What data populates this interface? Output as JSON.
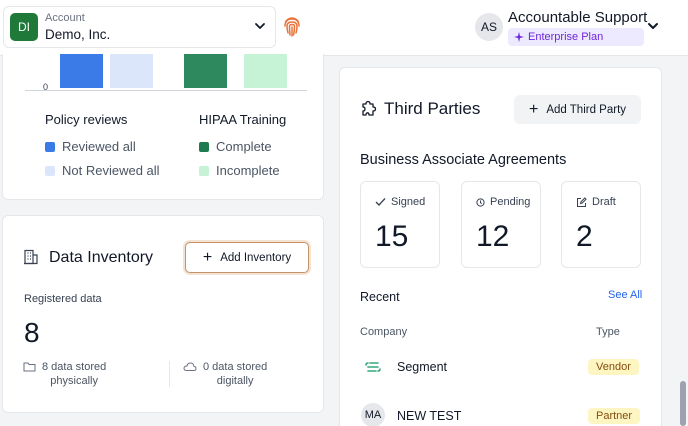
{
  "topbar": {
    "account": {
      "label": "Account",
      "initials": "DI",
      "name": "Demo, Inc."
    },
    "user": {
      "initials": "AS",
      "name": "Accountable Support",
      "plan": "Enterprise Plan"
    }
  },
  "policy_card": {
    "axis_zero": "0",
    "bars": [
      {
        "series": "Reviewed all",
        "color": "#3b7be8"
      },
      {
        "series": "Not Reviewed all",
        "color": "#dbe6fb"
      },
      {
        "series": "Complete",
        "color": "#2e8a5e"
      },
      {
        "series": "Incomplete",
        "color": "#c6f2d5"
      }
    ],
    "policy_reviews": {
      "title": "Policy reviews",
      "items": [
        {
          "label": "Reviewed all",
          "color": "#3b7be8"
        },
        {
          "label": "Not Reviewed all",
          "color": "#dbe6fb"
        }
      ]
    },
    "hipaa": {
      "title": "HIPAA Training",
      "items": [
        {
          "label": "Complete",
          "color": "#1f7a52"
        },
        {
          "label": "Incomplete",
          "color": "#c6f2d5"
        }
      ]
    }
  },
  "inventory": {
    "title": "Data Inventory",
    "add_label": "Add Inventory",
    "registered_label": "Registered data",
    "registered_value": "8",
    "physical": {
      "line1": "8 data stored",
      "line2": "physically"
    },
    "digital": {
      "line1": "0 data stored",
      "line2": "digitally"
    }
  },
  "third_parties": {
    "title": "Third Parties",
    "add_label": "Add Third Party",
    "baa_title": "Business Associate Agreements",
    "stats": [
      {
        "label": "Signed",
        "value": "15",
        "icon": "check-icon"
      },
      {
        "label": "Pending",
        "value": "12",
        "icon": "clock-icon"
      },
      {
        "label": "Draft",
        "value": "2",
        "icon": "edit-icon"
      }
    ],
    "recent_title": "Recent",
    "see_all": "See All",
    "col_company": "Company",
    "col_type": "Type",
    "rows": [
      {
        "company": "Segment",
        "type": "Vendor",
        "logo": "segment-logo"
      },
      {
        "company": "NEW TEST",
        "type": "Partner",
        "initials": "MA"
      }
    ]
  },
  "colors": {
    "accent": "#2563eb",
    "brand_green": "#1f7a3a",
    "plan_purple": "#6d28d9",
    "badge_yellow": "#fdf6c3"
  }
}
